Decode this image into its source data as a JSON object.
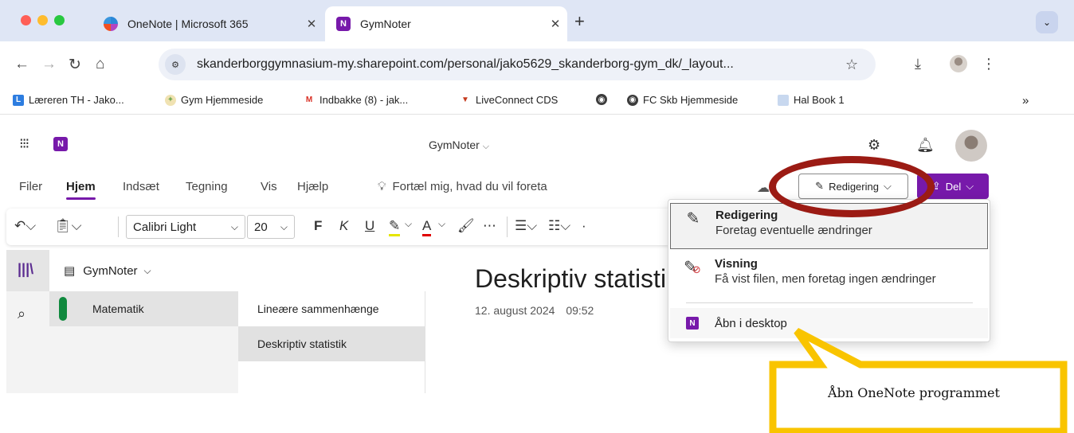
{
  "browser": {
    "tabs": [
      {
        "title": "OneNote | Microsoft 365",
        "favicon": "microsoft-365-icon"
      },
      {
        "title": "GymNoter",
        "favicon": "onenote-icon",
        "active": true
      }
    ],
    "new_tab": "+",
    "url": "skanderborggymnasium-my.sharepoint.com/personal/jako5629_skanderborg-gym_dk/_layout..."
  },
  "bookmarks": [
    {
      "label": "Læreren TH - Jako...",
      "icon": "L"
    },
    {
      "label": "Gym Hjemmeside",
      "icon": "gym-icon"
    },
    {
      "label": "Indbakke (8) - jak...",
      "icon": "M"
    },
    {
      "label": "LiveConnect CDS",
      "icon": "liveconnect-icon"
    },
    {
      "label": "",
      "icon": "globe-icon"
    },
    {
      "label": "FC Skb Hjemmeside",
      "icon": "globe-icon"
    },
    {
      "label": "Hal Book 1",
      "icon": "document-icon"
    }
  ],
  "bookmarks_more": "»",
  "onenote": {
    "app_letter": "N",
    "doc_title": "GymNoter",
    "ribbon_tabs": [
      "Filer",
      "Hjem",
      "Indsæt",
      "Tegning",
      "Vis",
      "Hjælp"
    ],
    "active_tab": "Hjem",
    "tell_me": "Fortæl mig, hvad du vil foreta",
    "mode_button": "Redigering",
    "share_button": "Del",
    "font_name": "Calibri Light",
    "font_size": "20",
    "fmt_bold": "F",
    "fmt_italic": "K",
    "fmt_underline": "U",
    "fmt_fontcolor": "A",
    "notebook": "GymNoter",
    "section": "Matematik",
    "pages": [
      "Lineære sammenhænge",
      "Deskriptiv statistik"
    ],
    "active_page": "Deskriptiv statistik",
    "page_title": "Deskriptiv statistik",
    "page_date": "12. august 2024",
    "page_time": "09:52"
  },
  "menu": {
    "items": [
      {
        "title": "Redigering",
        "subtitle": "Foretag eventuelle ændringer",
        "icon": "pencil-icon"
      },
      {
        "title": "Visning",
        "subtitle": "Få vist filen, men foretag ingen ændringer",
        "icon": "no-edit-icon"
      },
      {
        "title": "Åbn i desktop",
        "icon": "onenote-icon"
      }
    ]
  },
  "annotation": {
    "callout_text": "Åbn OneNote programmet",
    "ellipse_color": "#9b1b14",
    "callout_color": "#f9c400"
  },
  "colors": {
    "accent": "#7719aa",
    "section": "#10893e"
  }
}
